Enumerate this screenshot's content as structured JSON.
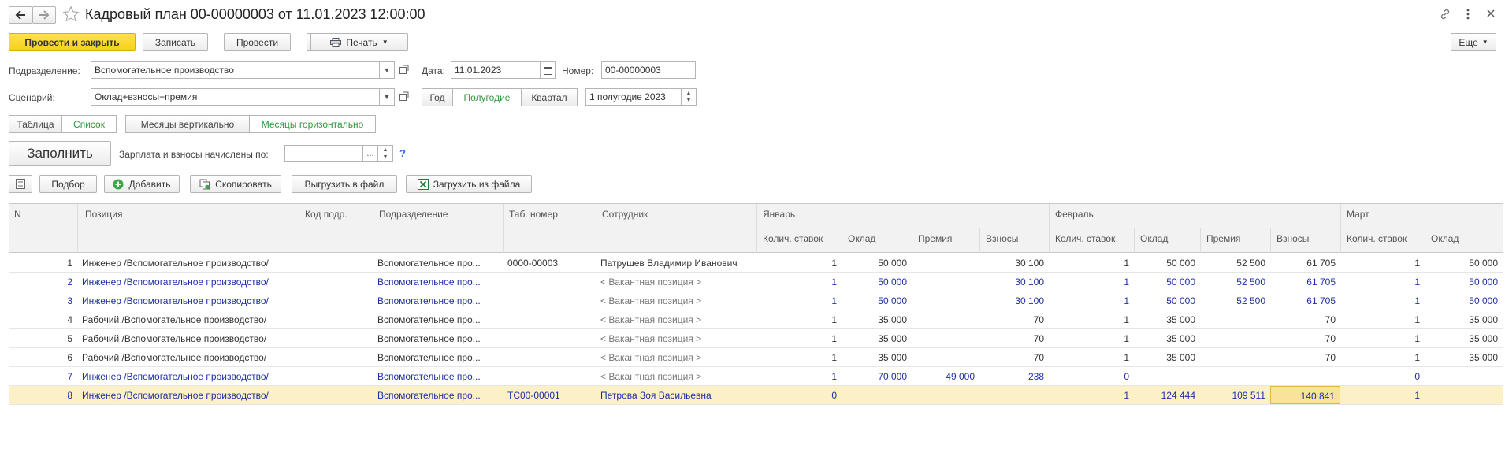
{
  "title": "Кадровый план 00-00000003 от 11.01.2023 12:00:00",
  "toolbar": {
    "post_close": "Провести и закрыть",
    "save": "Записать",
    "post": "Провести",
    "print": "Печать",
    "more": "Еще"
  },
  "form": {
    "department_label": "Подразделение:",
    "department_value": "Вспомогательное производство",
    "date_label": "Дата:",
    "date_value": "11.01.2023",
    "number_label": "Номер:",
    "number_value": "00-00000003",
    "scenario_label": "Сценарий:",
    "scenario_value": "Оклад+взносы+премия",
    "period_year": "Год",
    "period_half": "Полугодие",
    "period_quarter": "Квартал",
    "period_value": "1 полугодие 2023"
  },
  "view": {
    "table": "Таблица",
    "list": "Список",
    "months_vertical": "Месяцы вертикально",
    "months_horizontal": "Месяцы горизонтально"
  },
  "fill": {
    "button": "Заполнить",
    "accrued_label": "Зарплата и взносы начислены по:",
    "accrued_value": "",
    "ellipsis": "...",
    "help": "?"
  },
  "table_toolbar": {
    "pick": "Подбор",
    "add": "Добавить",
    "copy": "Скопировать",
    "export": "Выгрузить в файл",
    "import": "Загрузить из файла"
  },
  "table": {
    "headers": {
      "n": "N",
      "position": "Позиция",
      "dept_code": "Код подр.",
      "department": "Подразделение",
      "tab_number": "Таб. номер",
      "employee": "Сотрудник",
      "january": "Январь",
      "february": "Февраль",
      "march": "Март",
      "rates": "Колич. ставок",
      "salary": "Оклад",
      "bonus": "Премия",
      "contrib": "Взносы"
    },
    "rows": [
      {
        "n": "1",
        "position": "Инженер /Вспомогательное производство/",
        "code": "",
        "dept": "Вспомогательное про...",
        "tab": "0000-00003",
        "emp": "Патрушев Владимир Иванович",
        "j_rates": "1",
        "j_salary": "50 000",
        "j_bonus": "",
        "j_contrib": "30 100",
        "f_rates": "1",
        "f_salary": "50 000",
        "f_bonus": "52 500",
        "f_contrib": "61 705",
        "m_rates": "1",
        "m_salary": "50 000"
      },
      {
        "n": "2",
        "position": "Инженер /Вспомогательное производство/",
        "code": "",
        "dept": "Вспомогательное про...",
        "tab": "",
        "emp": "< Вакантная позиция >",
        "j_rates": "1",
        "j_salary": "50 000",
        "j_bonus": "",
        "j_contrib": "30 100",
        "f_rates": "1",
        "f_salary": "50 000",
        "f_bonus": "52 500",
        "f_contrib": "61 705",
        "m_rates": "1",
        "m_salary": "50 000"
      },
      {
        "n": "3",
        "position": "Инженер /Вспомогательное производство/",
        "code": "",
        "dept": "Вспомогательное про...",
        "tab": "",
        "emp": "< Вакантная позиция >",
        "j_rates": "1",
        "j_salary": "50 000",
        "j_bonus": "",
        "j_contrib": "30 100",
        "f_rates": "1",
        "f_salary": "50 000",
        "f_bonus": "52 500",
        "f_contrib": "61 705",
        "m_rates": "1",
        "m_salary": "50 000"
      },
      {
        "n": "4",
        "position": "Рабочий /Вспомогательное производство/",
        "code": "",
        "dept": "Вспомогательное про...",
        "tab": "",
        "emp": "< Вакантная позиция >",
        "j_rates": "1",
        "j_salary": "35 000",
        "j_bonus": "",
        "j_contrib": "70",
        "f_rates": "1",
        "f_salary": "35 000",
        "f_bonus": "",
        "f_contrib": "70",
        "m_rates": "1",
        "m_salary": "35 000"
      },
      {
        "n": "5",
        "position": "Рабочий /Вспомогательное производство/",
        "code": "",
        "dept": "Вспомогательное про...",
        "tab": "",
        "emp": "< Вакантная позиция >",
        "j_rates": "1",
        "j_salary": "35 000",
        "j_bonus": "",
        "j_contrib": "70",
        "f_rates": "1",
        "f_salary": "35 000",
        "f_bonus": "",
        "f_contrib": "70",
        "m_rates": "1",
        "m_salary": "35 000"
      },
      {
        "n": "6",
        "position": "Рабочий /Вспомогательное производство/",
        "code": "",
        "dept": "Вспомогательное про...",
        "tab": "",
        "emp": "< Вакантная позиция >",
        "j_rates": "1",
        "j_salary": "35 000",
        "j_bonus": "",
        "j_contrib": "70",
        "f_rates": "1",
        "f_salary": "35 000",
        "f_bonus": "",
        "f_contrib": "70",
        "m_rates": "1",
        "m_salary": "35 000"
      },
      {
        "n": "7",
        "position": "Инженер /Вспомогательное производство/",
        "code": "",
        "dept": "Вспомогательное про...",
        "tab": "",
        "emp": "< Вакантная позиция >",
        "j_rates": "1",
        "j_salary": "70 000",
        "j_bonus": "49 000",
        "j_contrib": "238",
        "f_rates": "0",
        "f_salary": "",
        "f_bonus": "",
        "f_contrib": "",
        "m_rates": "0",
        "m_salary": ""
      },
      {
        "n": "8",
        "position": "Инженер /Вспомогательное производство/",
        "code": "",
        "dept": "Вспомогательное про...",
        "tab": "ТС00-00001",
        "emp": "Петрова Зоя Васильевна",
        "j_rates": "0",
        "j_salary": "",
        "j_bonus": "",
        "j_contrib": "",
        "f_rates": "1",
        "f_salary": "124 444",
        "f_bonus": "109 511",
        "f_contrib": "140 841",
        "m_rates": "1",
        "m_salary": ""
      }
    ]
  }
}
